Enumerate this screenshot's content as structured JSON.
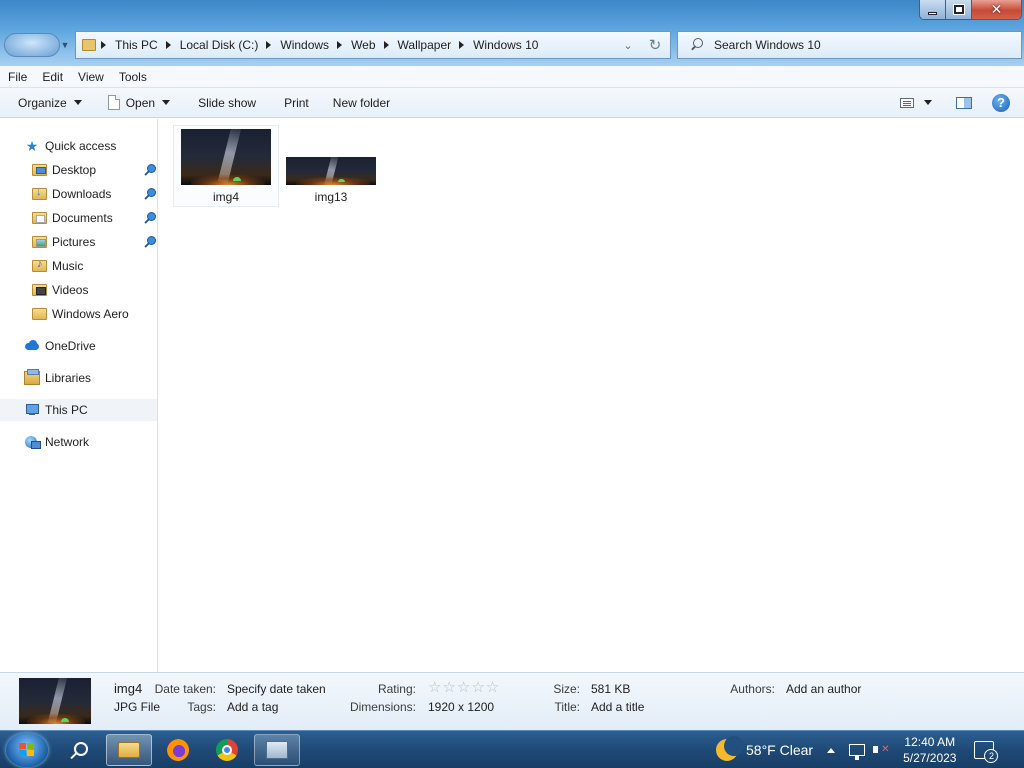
{
  "address": {
    "crumbs": [
      "This PC",
      "Local Disk (C:)",
      "Windows",
      "Web",
      "Wallpaper",
      "Windows 10"
    ]
  },
  "search": {
    "placeholder": "Search Windows 10"
  },
  "menu": [
    "File",
    "Edit",
    "View",
    "Tools"
  ],
  "toolbar": {
    "organize": "Organize",
    "open": "Open",
    "slideshow": "Slide show",
    "print": "Print",
    "newfolder": "New folder",
    "help": "?"
  },
  "nav": {
    "quick_access": "Quick access",
    "desktop": "Desktop",
    "downloads": "Downloads",
    "documents": "Documents",
    "pictures": "Pictures",
    "music": "Music",
    "videos": "Videos",
    "windows_aero": "Windows Aero",
    "onedrive": "OneDrive",
    "libraries": "Libraries",
    "thispc": "This PC",
    "network": "Network"
  },
  "files": [
    {
      "name": "img4"
    },
    {
      "name": "img13"
    }
  ],
  "details": {
    "name": "img4",
    "type": "JPG File",
    "date_taken_label": "Date taken:",
    "date_taken_value": "Specify date taken",
    "tags_label": "Tags:",
    "tags_value": "Add a tag",
    "rating_label": "Rating:",
    "rating_stars": "☆☆☆☆☆",
    "rating_value": 0,
    "dimensions_label": "Dimensions:",
    "dimensions_value": "1920 x 1200",
    "size_label": "Size:",
    "size_value": "581 KB",
    "title_label": "Title:",
    "title_value": "Add a title",
    "authors_label": "Authors:",
    "authors_value": "Add an author"
  },
  "taskbar": {
    "weather": "58°F  Clear",
    "time": "12:40 AM",
    "date": "5/27/2023",
    "notifications": "2"
  },
  "colors": {
    "titlebar": "#5da6df",
    "taskbar": "#1f4a77",
    "close_button": "#c74a36"
  },
  "icons": {
    "quick_access": "star-icon",
    "onedrive": "cloud-icon",
    "thispc": "computer-icon",
    "network": "network-icon",
    "help": "help-icon"
  }
}
